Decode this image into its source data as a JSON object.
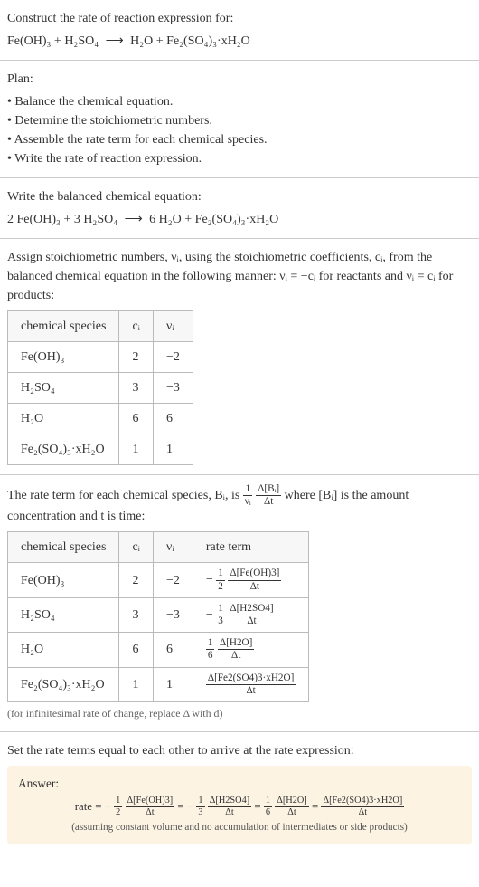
{
  "intro": {
    "prompt": "Construct the rate of reaction expression for:",
    "equation_left": "Fe(OH)₃ + H₂SO₄",
    "arrow": "⟶",
    "equation_right": "H₂O + Fe₂(SO₄)₃·xH₂O"
  },
  "plan": {
    "label": "Plan:",
    "items": [
      "Balance the chemical equation.",
      "Determine the stoichiometric numbers.",
      "Assemble the rate term for each chemical species.",
      "Write the rate of reaction expression."
    ]
  },
  "balanced": {
    "label": "Write the balanced chemical equation:",
    "equation_left": "2 Fe(OH)₃ + 3 H₂SO₄",
    "arrow": "⟶",
    "equation_right": "6 H₂O + Fe₂(SO₄)₃·xH₂O"
  },
  "assign": {
    "text_before": "Assign stoichiometric numbers, νᵢ, using the stoichiometric coefficients, cᵢ, from the balanced chemical equation in the following manner: νᵢ = −cᵢ for reactants and νᵢ = cᵢ for products:",
    "headers": [
      "chemical species",
      "cᵢ",
      "νᵢ"
    ],
    "rows": [
      {
        "species": "Fe(OH)₃",
        "c": "2",
        "v": "−2"
      },
      {
        "species": "H₂SO₄",
        "c": "3",
        "v": "−3"
      },
      {
        "species": "H₂O",
        "c": "6",
        "v": "6"
      },
      {
        "species": "Fe₂(SO₄)₃·xH₂O",
        "c": "1",
        "v": "1"
      }
    ]
  },
  "rateterm_intro": {
    "text1": "The rate term for each chemical species, Bᵢ, is ",
    "frac1_num": "1",
    "frac1_den": "νᵢ",
    "frac2_num": "Δ[Bᵢ]",
    "frac2_den": "Δt",
    "text2": " where [Bᵢ] is the amount concentration and t is time:"
  },
  "rateterm_table": {
    "headers": [
      "chemical species",
      "cᵢ",
      "νᵢ",
      "rate term"
    ],
    "rows": [
      {
        "species": "Fe(OH)₃",
        "c": "2",
        "v": "−2",
        "coef_sign": "−",
        "coef_num": "1",
        "coef_den": "2",
        "delta_num": "Δ[Fe(OH)3]",
        "delta_den": "Δt"
      },
      {
        "species": "H₂SO₄",
        "c": "3",
        "v": "−3",
        "coef_sign": "−",
        "coef_num": "1",
        "coef_den": "3",
        "delta_num": "Δ[H2SO4]",
        "delta_den": "Δt"
      },
      {
        "species": "H₂O",
        "c": "6",
        "v": "6",
        "coef_sign": "",
        "coef_num": "1",
        "coef_den": "6",
        "delta_num": "Δ[H2O]",
        "delta_den": "Δt"
      },
      {
        "species": "Fe₂(SO₄)₃·xH₂O",
        "c": "1",
        "v": "1",
        "coef_sign": "",
        "coef_num": "",
        "coef_den": "",
        "delta_num": "Δ[Fe2(SO4)3·xH2O]",
        "delta_den": "Δt"
      }
    ],
    "note": "(for infinitesimal rate of change, replace Δ with d)"
  },
  "final": {
    "prompt": "Set the rate terms equal to each other to arrive at the rate expression:",
    "answer_label": "Answer:",
    "rate_label": "rate = ",
    "terms": [
      {
        "sign": "−",
        "num": "1",
        "den": "2",
        "dnum": "Δ[Fe(OH)3]",
        "dden": "Δt"
      },
      {
        "sign": "−",
        "num": "1",
        "den": "3",
        "dnum": "Δ[H2SO4]",
        "dden": "Δt"
      },
      {
        "sign": "",
        "num": "1",
        "den": "6",
        "dnum": "Δ[H2O]",
        "dden": "Δt"
      },
      {
        "sign": "",
        "num": "",
        "den": "",
        "dnum": "Δ[Fe2(SO4)3·xH2O]",
        "dden": "Δt"
      }
    ],
    "eq": " = ",
    "note": "(assuming constant volume and no accumulation of intermediates or side products)"
  }
}
